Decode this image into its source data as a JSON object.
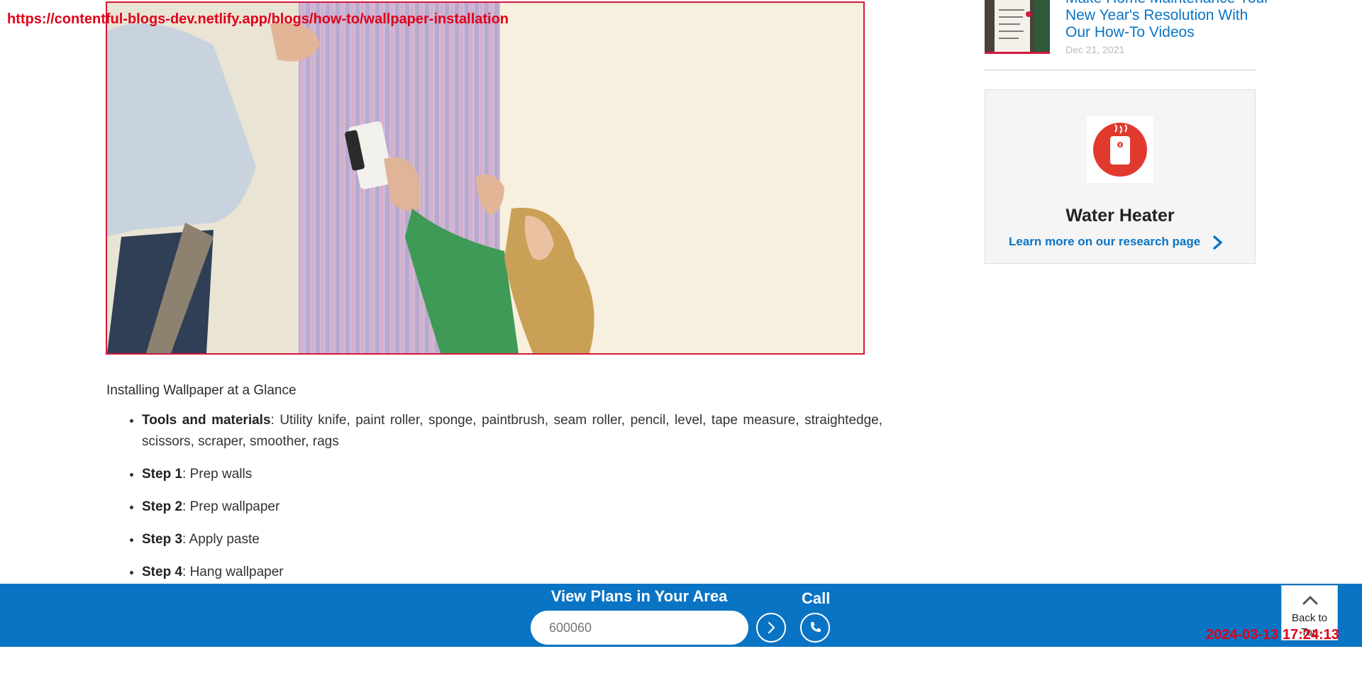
{
  "overlay": {
    "url": "https://contentful-blogs-dev.netlify.app/blogs/how-to/wallpaper-installation",
    "timestamp": "2024-03-13 17:24:13"
  },
  "article": {
    "glance_heading": "Installing Wallpaper at a Glance",
    "items": [
      {
        "label": "Tools and materials",
        "text": ": Utility knife, paint roller, sponge, paintbrush, seam roller, pencil, level, tape measure, straightedge, scissors, scraper, smoother, rags"
      },
      {
        "label": "Step 1",
        "text": ": Prep walls"
      },
      {
        "label": "Step 2",
        "text": ": Prep wallpaper"
      },
      {
        "label": "Step 3",
        "text": ": Apply paste"
      },
      {
        "label": "Step 4",
        "text": ": Hang wallpaper"
      }
    ]
  },
  "sidebar": {
    "related_post": {
      "title": "Make Home Maintenance Your New Year's Resolution With Our How-To Videos",
      "date": "Dec 21, 2021"
    },
    "research_card": {
      "icon": "water-heater-icon",
      "title": "Water Heater",
      "link_label": "Learn more on our research page"
    }
  },
  "plans_bar": {
    "heading": "View Plans in Your Area",
    "zip_value": "600060",
    "call_label": "Call",
    "back_to_top_label": "Back to Top"
  },
  "colors": {
    "brand_blue": "#0a74c4",
    "accent_red": "#d6173b",
    "icon_red": "#e2392f"
  }
}
